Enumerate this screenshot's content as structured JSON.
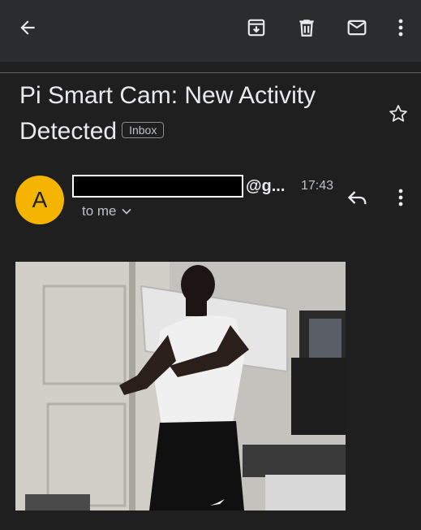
{
  "toolbar": {
    "icons": [
      "back-arrow-icon",
      "archive-icon",
      "trash-icon",
      "mail-icon",
      "more-vert-icon"
    ]
  },
  "email": {
    "subject": "Pi Smart Cam: New Activity Detected",
    "label": "Inbox",
    "starred": false,
    "sender": {
      "avatar_letter": "A",
      "avatar_color": "#f4b400",
      "domain_suffix": "@g..."
    },
    "time": "17:43",
    "recipient": "to me"
  },
  "colors": {
    "background": "#1f1f1f",
    "appbar": "#2b2c2e",
    "text": "#e8eaed",
    "secondary_text": "#bdc1c6"
  }
}
